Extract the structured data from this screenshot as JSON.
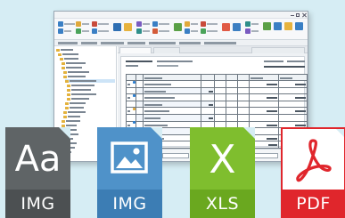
{
  "tiles": {
    "text": {
      "glyph": "Aa",
      "label": "IMG",
      "color": "#5f6466"
    },
    "image": {
      "label": "IMG",
      "color": "#4f92c9"
    },
    "excel": {
      "glyph": "X",
      "label": "XLS",
      "color": "#7fbe2e"
    },
    "pdf": {
      "label": "PDF",
      "color": "#e0262c"
    }
  },
  "colors": {
    "background": "#d6edf4",
    "folder": "#e3b23c",
    "selection": "#cde4f7"
  },
  "icons": [
    "font-icon",
    "image-icon",
    "excel-icon",
    "acrobat-icon",
    "folder-icon"
  ]
}
